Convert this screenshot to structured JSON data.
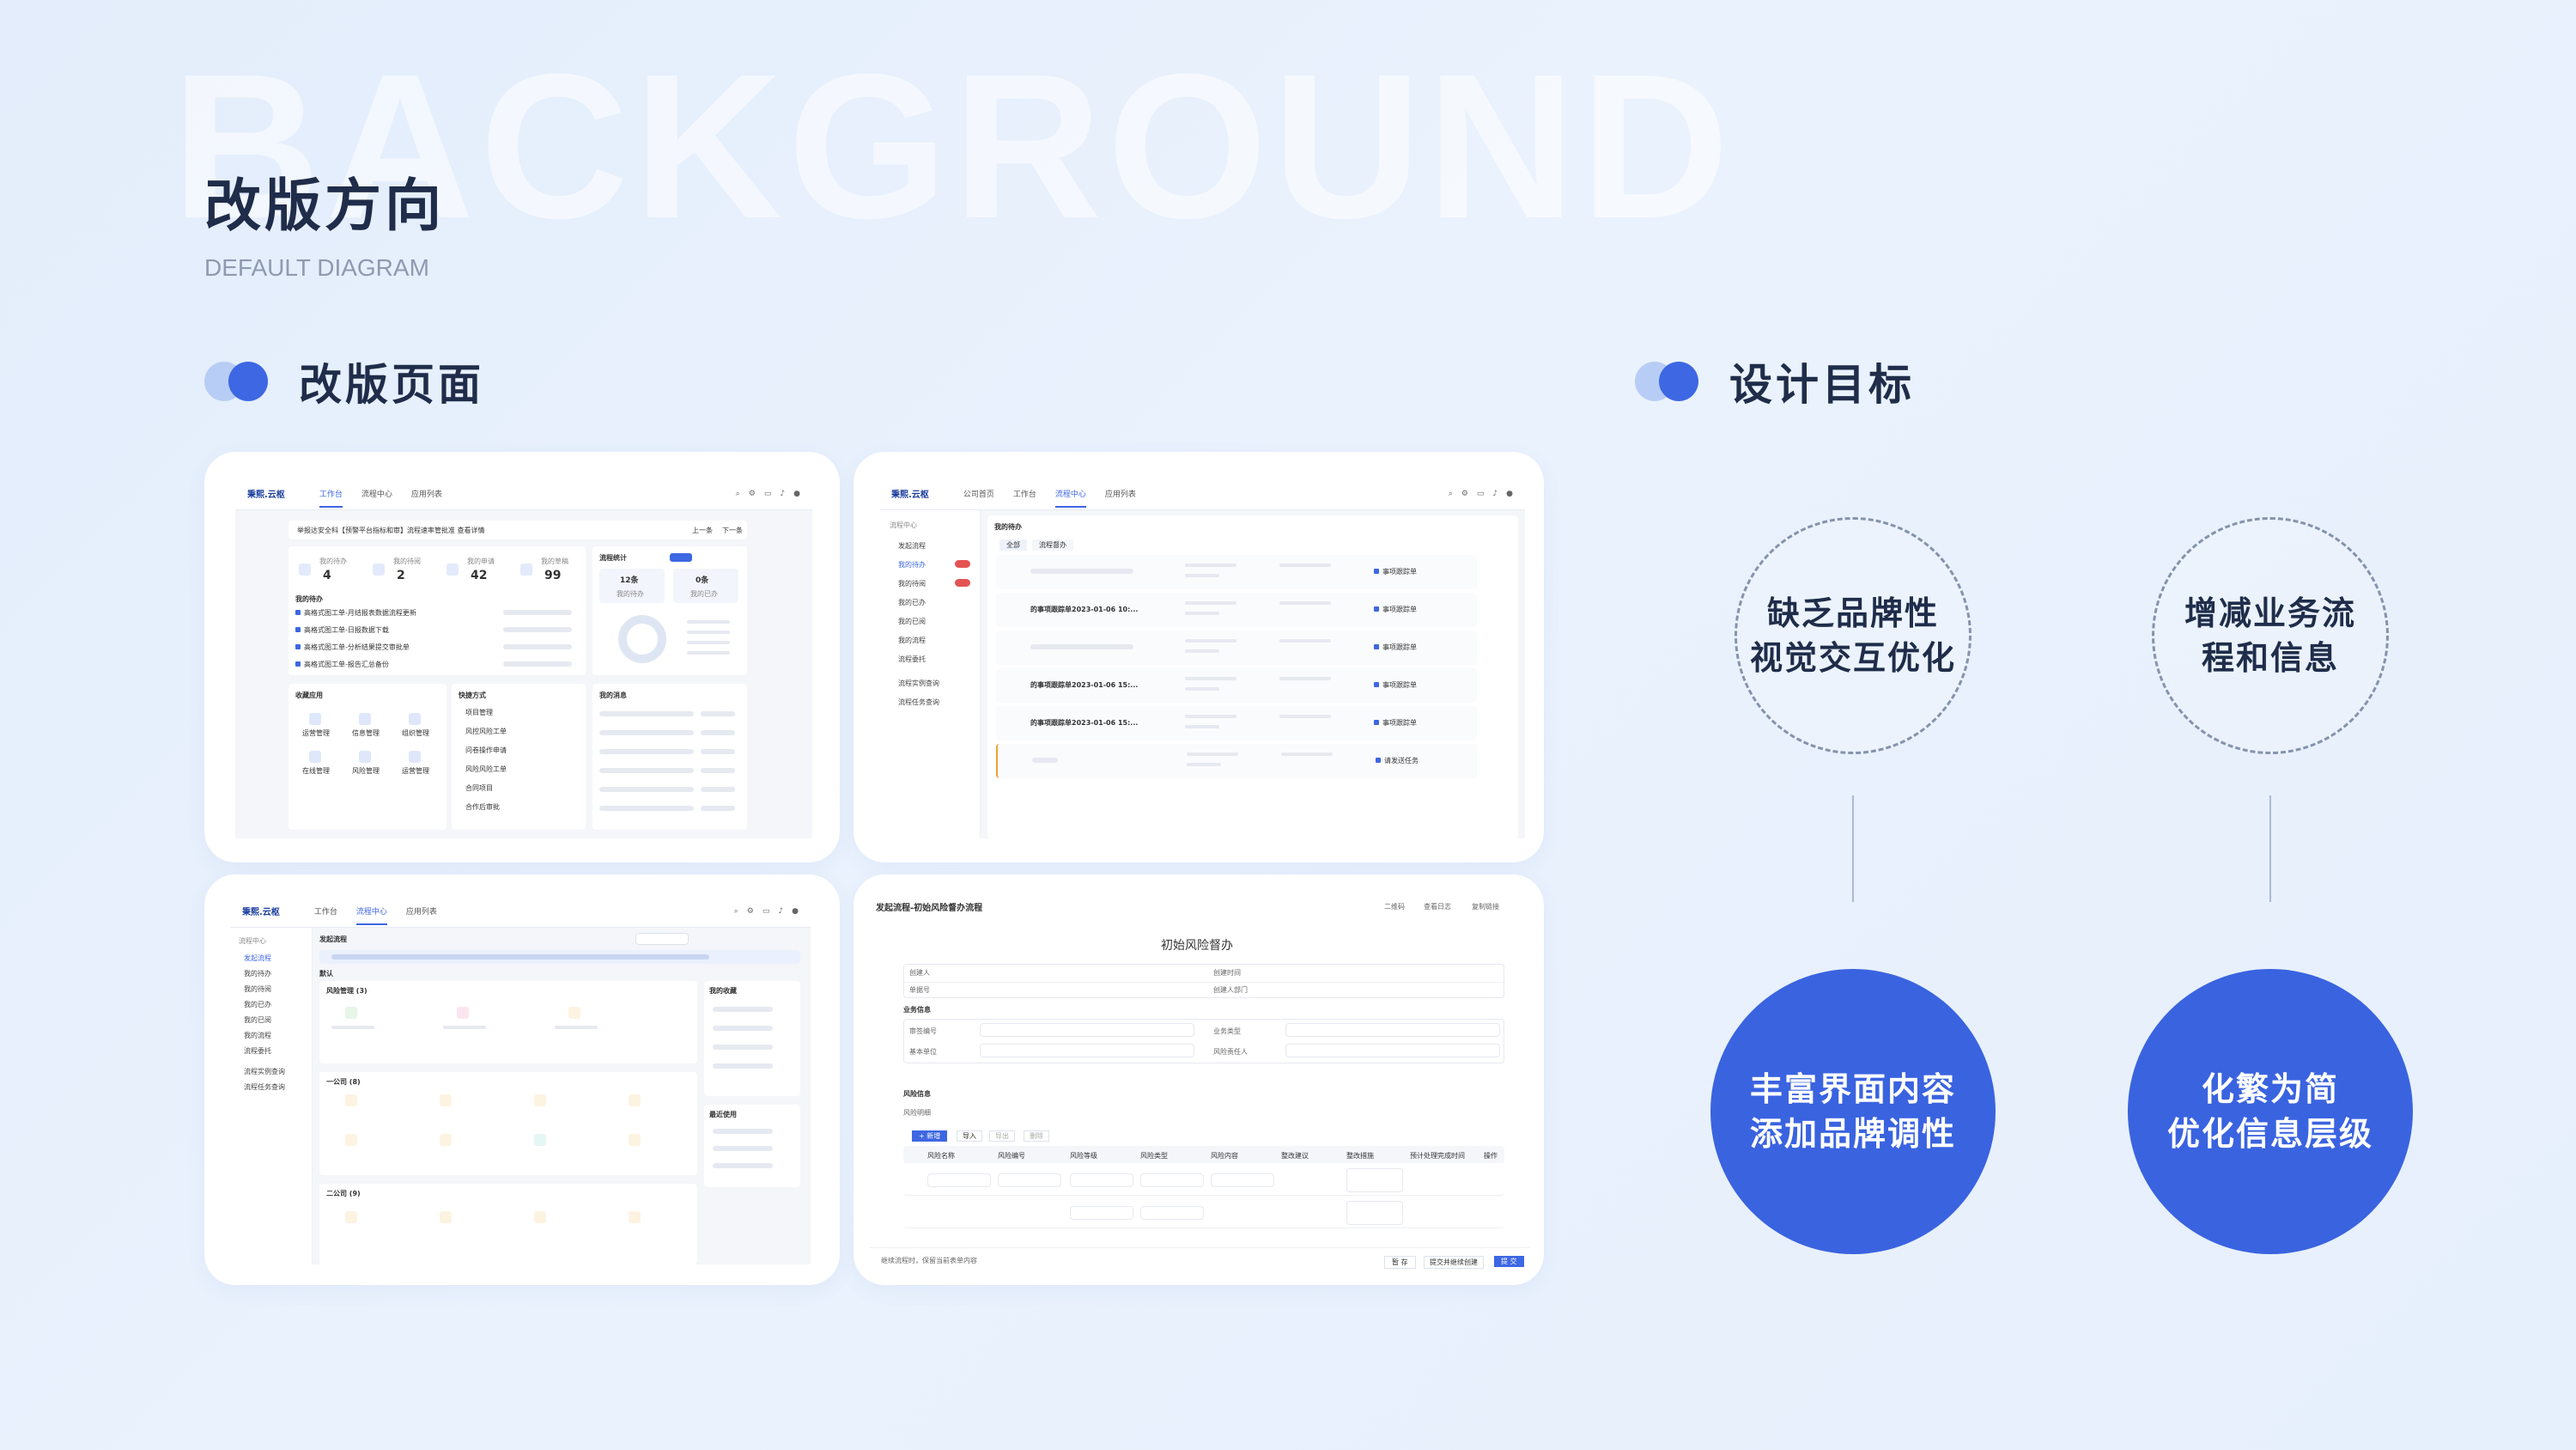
{
  "background_word": "BACKGROUND",
  "title": "改版方向",
  "subtitle": "DEFAULT DIAGRAM",
  "sections": {
    "pages": "改版页面",
    "goals": "设计目标"
  },
  "goals": {
    "problems": [
      {
        "line1": "缺乏品牌性",
        "line2": "视觉交互优化"
      },
      {
        "line1": "增减业务流",
        "line2": "程和信息"
      }
    ],
    "solutions": [
      {
        "line1": "丰富界面内容",
        "line2": "添加品牌调性"
      },
      {
        "line1": "化繁为简",
        "line2": "优化信息层级"
      }
    ]
  },
  "colors": {
    "accent": "#3a63e0",
    "light_accent": "#b7cdf5",
    "title": "#1f2d4a"
  },
  "screens": {
    "workbench": {
      "brand": "秉熙.云枢",
      "nav": [
        "工作台",
        "流程中心",
        "应用列表"
      ],
      "notice": "举报达安全科【预警平台指标和审】流程速率管批准 查看详情",
      "notice_btns": [
        "上一条",
        "下一条"
      ],
      "stats": [
        {
          "label": "我的待办",
          "value": "4"
        },
        {
          "label": "我的待阅",
          "value": "2"
        },
        {
          "label": "我的申请",
          "value": "42"
        },
        {
          "label": "我的草稿",
          "value": "99"
        }
      ],
      "flow_stats_title": "流程统计",
      "flow_stats": [
        {
          "value": "12条",
          "label": "我的待办"
        },
        {
          "value": "0条",
          "label": "我的已办"
        }
      ],
      "todo_title": "我的待办",
      "todo_items": [
        "高格式图工单-月结报表数据流程更新",
        "高格式图工单-日报数据下载",
        "高格式图工单-分析结果提交审批单",
        "高格式图工单-报告汇总备份"
      ],
      "favorites_title": "收藏应用",
      "favorites": [
        "运营管理",
        "信息管理",
        "组织管理",
        "在线管理",
        "风险管理",
        "运营管理"
      ],
      "shortcuts_title": "快捷方式",
      "shortcuts": [
        "项目管理",
        "风控风险工单",
        "问卷操作申请",
        "风险风险工单",
        "合同项目",
        "合作后审批"
      ],
      "news_title": "我的消息"
    },
    "flow_center": {
      "brand": "秉熙.云枢",
      "nav": [
        "公司首页",
        "工作台",
        "流程中心",
        "应用列表"
      ],
      "side_title": "流程中心",
      "side_items": [
        "发起流程",
        "我的待办",
        "我的待阅",
        "我的已办",
        "我的已阅",
        "我的流程",
        "流程委托",
        "流程实例查询",
        "流程任务查询"
      ],
      "list_title": "我的待办",
      "tabs": [
        "全部",
        "流程督办"
      ],
      "row_titles": [
        "的事项跟踪单2023-01-06 10:...",
        "的事项跟踪单2023-01-06 15:...",
        "的事项跟踪单2023-01-06 15:..."
      ],
      "row_tags": [
        "事项跟踪单",
        "事项跟踪单",
        "事项跟踪单",
        "事项跟踪单",
        "事项跟踪单",
        "请发送任务"
      ]
    },
    "launch_flow": {
      "brand": "秉熙.云枢",
      "nav": [
        "工作台",
        "流程中心",
        "应用列表"
      ],
      "side_title": "流程中心",
      "side_items": [
        "发起流程",
        "我的待办",
        "我的待阅",
        "我的已办",
        "我的已阅",
        "我的流程",
        "流程委托",
        "流程实例查询",
        "流程任务查询"
      ],
      "page_title": "发起流程",
      "default_group": "默认",
      "groups": [
        "风险管理 (3)",
        "一公司 (8)",
        "二公司 (9)"
      ],
      "favorites_title": "我的收藏",
      "recent_title": "最近使用"
    },
    "risk_form": {
      "header": "发起流程-初始风险督办流程",
      "header_actions": [
        "二维码",
        "查看日志",
        "复制链接"
      ],
      "form_title": "初始风险督办",
      "fields": [
        "创建人",
        "创建时间",
        "单据号",
        "创建人部门"
      ],
      "section_business": "业务信息",
      "business_fields": [
        "审签编号",
        "业务类型",
        "基本单位",
        "风险责任人"
      ],
      "section_risk": "风险信息",
      "sub_table": "风险明细",
      "table_buttons": [
        "+ 新增",
        "导入",
        "导出",
        "删除"
      ],
      "columns": [
        "风险名称",
        "风险编号",
        "风险等级",
        "风险类型",
        "风险内容",
        "整改建议",
        "整改措施",
        "预计处理完成时间",
        "操作"
      ],
      "footer_note": "继续流程时，保留当前表单内容",
      "footer_buttons": [
        "暂 存",
        "提交并继续创建",
        "提 交"
      ]
    }
  }
}
